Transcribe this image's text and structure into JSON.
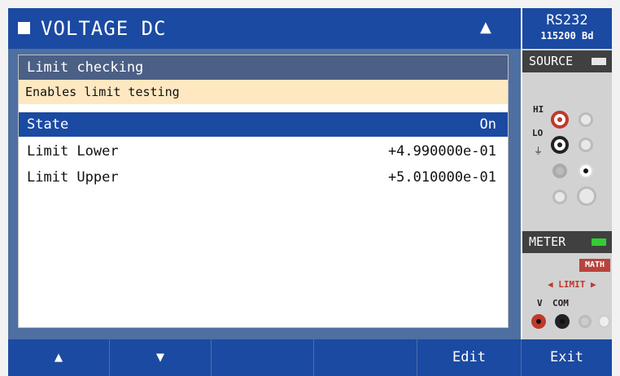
{
  "header": {
    "title": "VOLTAGE DC",
    "warning_icon": "warning-triangle-icon",
    "interface": "RS232",
    "baud": "115200 Bd"
  },
  "panel": {
    "heading": "Limit checking",
    "hint": "Enables limit testing",
    "rows": [
      {
        "label": "State",
        "value": "On",
        "selected": true
      },
      {
        "label": "Limit Lower",
        "value": "+4.990000e-01",
        "selected": false
      },
      {
        "label": "Limit Upper",
        "value": "+5.010000e-01",
        "selected": false
      }
    ]
  },
  "source": {
    "label": "SOURCE",
    "hi": "HI",
    "lo": "LO",
    "indicator_color": "#e6e6e6"
  },
  "meter": {
    "label": "METER",
    "indicator_color": "#33cc33",
    "math": "MATH",
    "limit": "◀ LIMIT ▶",
    "v": "V",
    "com": "COM"
  },
  "softkeys": [
    {
      "label": "▲",
      "icon": "up-arrow-icon"
    },
    {
      "label": "▼",
      "icon": "down-arrow-icon"
    },
    {
      "label": ""
    },
    {
      "label": ""
    },
    {
      "label": "Edit"
    },
    {
      "label": "Exit"
    }
  ],
  "colors": {
    "accent": "#1b4aa2",
    "hint_bg": "#fde8c1",
    "header_bar": "#4c5f85"
  }
}
